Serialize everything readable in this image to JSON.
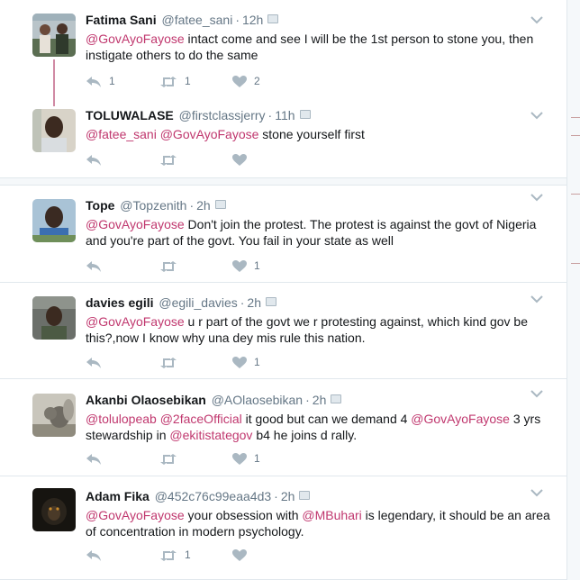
{
  "tweets": [
    {
      "name": "Fatima Sani",
      "handle": "@fatee_sani",
      "time": "12h",
      "body": [
        {
          "t": "@GovAyoFayose",
          "m": true
        },
        {
          "t": " intact come and see I will be the 1st person to stone you, then instigate others to do the same",
          "m": false
        }
      ],
      "reply_count": "1",
      "retweet_count": "1",
      "like_count": "2",
      "avatar": "group-photo-avatar"
    },
    {
      "name": "TOLUWALASE",
      "handle": "@firstclassjerry",
      "time": "11h",
      "body": [
        {
          "t": "@fatee_sani",
          "m": true
        },
        {
          "t": " ",
          "m": false
        },
        {
          "t": "@GovAyoFayose",
          "m": true
        },
        {
          "t": " stone yourself first",
          "m": false
        }
      ],
      "reply_count": "",
      "retweet_count": "",
      "like_count": "",
      "avatar": "man-portrait-avatar"
    },
    {
      "name": "Tope",
      "handle": "@Topzenith",
      "time": "2h",
      "body": [
        {
          "t": "@GovAyoFayose",
          "m": true
        },
        {
          "t": " Don't join the protest. The protest is against the govt of Nigeria and you're part of the govt. You fail in your state as well",
          "m": false
        }
      ],
      "reply_count": "",
      "retweet_count": "",
      "like_count": "1",
      "avatar": "man-outdoor-avatar"
    },
    {
      "name": "davies egili",
      "handle": "@egili_davies",
      "time": "2h",
      "body": [
        {
          "t": "@GovAyoFayose",
          "m": true
        },
        {
          "t": " u r part of the govt we r protesting against, which kind gov be this?,now I know why una dey mis rule this nation.",
          "m": false
        }
      ],
      "reply_count": "",
      "retweet_count": "",
      "like_count": "1",
      "avatar": "man-car-avatar"
    },
    {
      "name": "Akanbi Olaosebikan",
      "handle": "@AOlaosebikan",
      "time": "2h",
      "body": [
        {
          "t": "@tolulopeab",
          "m": true
        },
        {
          "t": " ",
          "m": false
        },
        {
          "t": "@2faceOfficial",
          "m": true
        },
        {
          "t": " it good but can we demand 4 ",
          "m": false
        },
        {
          "t": "@GovAyoFayose",
          "m": true
        },
        {
          "t": "  3 yrs stewardship in ",
          "m": false
        },
        {
          "t": "@ekitistategov",
          "m": true
        },
        {
          "t": " b4 he joins d rally.",
          "m": false
        }
      ],
      "reply_count": "",
      "retweet_count": "",
      "like_count": "1",
      "avatar": "squirrel-avatar"
    },
    {
      "name": "Adam Fika",
      "handle": "@452c76c99eaa4d3",
      "time": "2h",
      "body": [
        {
          "t": "@GovAyoFayose",
          "m": true
        },
        {
          "t": " your obsession with ",
          "m": false
        },
        {
          "t": "@MBuhari",
          "m": true
        },
        {
          "t": " is legendary, it should be an area of concentration in modern psychology.",
          "m": false
        }
      ],
      "reply_count": "",
      "retweet_count": "1",
      "like_count": "",
      "avatar": "monkey-avatar"
    }
  ],
  "icons": {
    "reply": "reply-icon",
    "retweet": "retweet-icon",
    "like": "heart-icon",
    "more": "chevron-down-icon",
    "device": "device-icon"
  },
  "colors": {
    "mention": "#c0376e",
    "muted": "#657786",
    "icon": "#aab8c2",
    "thread": "#d08aa4"
  }
}
